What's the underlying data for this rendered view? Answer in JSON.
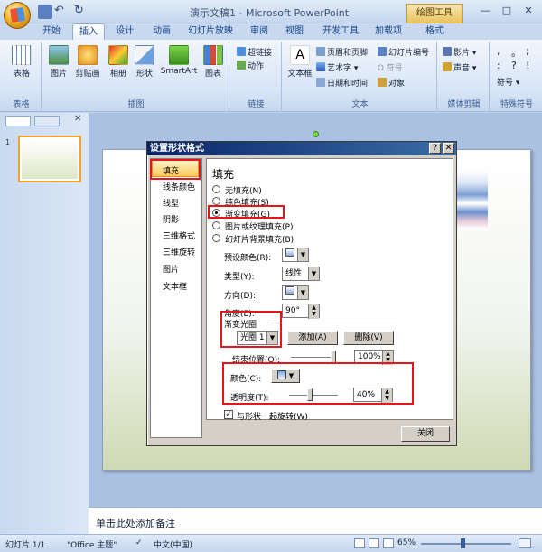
{
  "window": {
    "title": "演示文稿1 - Microsoft PowerPoint",
    "context_tab": "绘图工具",
    "min": "—",
    "max": "□",
    "close": "✕"
  },
  "tabs": [
    "开始",
    "插入",
    "设计",
    "动画",
    "幻灯片放映",
    "审阅",
    "视图",
    "开发工具",
    "加载项",
    "格式"
  ],
  "ribbon": {
    "groups": {
      "tables": "表格",
      "illustrations": "插图",
      "links": "链接",
      "text": "文本",
      "media": "媒体剪辑",
      "special": "特殊符号"
    },
    "table": "表格",
    "picture": "图片",
    "clipart": "剪贴画",
    "album": "相册",
    "shapes": "形状",
    "smartart": "SmartArt",
    "chart": "图表",
    "hyperlink": "超链接",
    "action": "动作",
    "textbox": "文本框",
    "header_footer": "页眉和页脚",
    "wordart": "艺术字",
    "datetime": "日期和时间",
    "slide_number": "幻灯片编号",
    "symbol": "符号",
    "object": "对象",
    "movie": "影片",
    "sound": "声音",
    "special_symbols": "符号",
    "punct": [
      ",",
      "。",
      ";",
      ":",
      "?",
      "!"
    ]
  },
  "left_pane": {
    "slide_number": "1"
  },
  "notes": {
    "placeholder": "单击此处添加备注"
  },
  "status": {
    "slide": "幻灯片 1/1",
    "theme": "\"Office 主题\"",
    "language": "中文(中国)",
    "zoom": "65%"
  },
  "dialog": {
    "title": "设置形状格式",
    "help": "?",
    "close": "✕",
    "categories": [
      "填充",
      "线条颜色",
      "线型",
      "阴影",
      "三维格式",
      "三维旋转",
      "图片",
      "文本框"
    ],
    "section_title": "填充",
    "fill_options": [
      "无填充(N)",
      "纯色填充(S)",
      "渐变填充(G)",
      "图片或纹理填充(P)",
      "幻灯片背景填充(B)"
    ],
    "preset_label": "预设颜色(R):",
    "type_label": "类型(Y):",
    "type_value": "线性",
    "direction_label": "方向(D):",
    "angle_label": "角度(E):",
    "angle_value": "90°",
    "stops_title": "渐变光圈",
    "stop_value": "光圈 1",
    "add_button": "添加(A)",
    "delete_button": "删除(V)",
    "end_position_label": "结束位置(O):",
    "end_position_value": "100%",
    "color_label": "颜色(C):",
    "transparency_label": "透明度(T):",
    "transparency_value": "40%",
    "rotate_label": "与形状一起旋转(W)",
    "close_button": "关闭"
  },
  "colors": {
    "accent": "#e8141c",
    "title_blue": "#0a246a",
    "selection": "#ffc95c"
  }
}
